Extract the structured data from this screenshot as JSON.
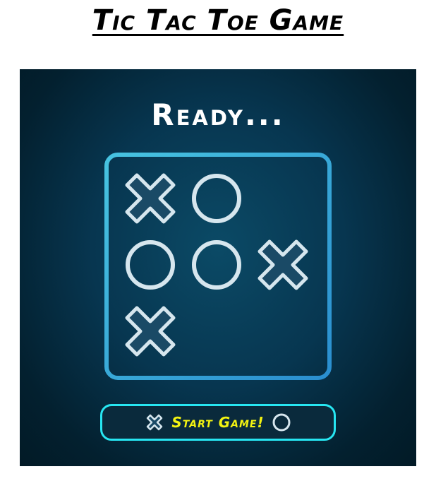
{
  "header": {
    "title": "Tic Tac Toe Game"
  },
  "game": {
    "status": "Ready...",
    "board": [
      "X",
      "O",
      "",
      "O",
      "O",
      "X",
      "X",
      "",
      ""
    ],
    "start_button_label": "Start Game!"
  },
  "colors": {
    "panel_background": "#073650",
    "grid_lines": "#3ec8ea",
    "mark_fill": "#1a4a66",
    "mark_stroke": "#d6e6ee",
    "button_border": "#27e6f2",
    "button_text": "#f3f312",
    "status_text": "#ffffff"
  },
  "icons": {
    "x_mark": "x-mark-icon",
    "o_mark": "o-mark-icon"
  }
}
